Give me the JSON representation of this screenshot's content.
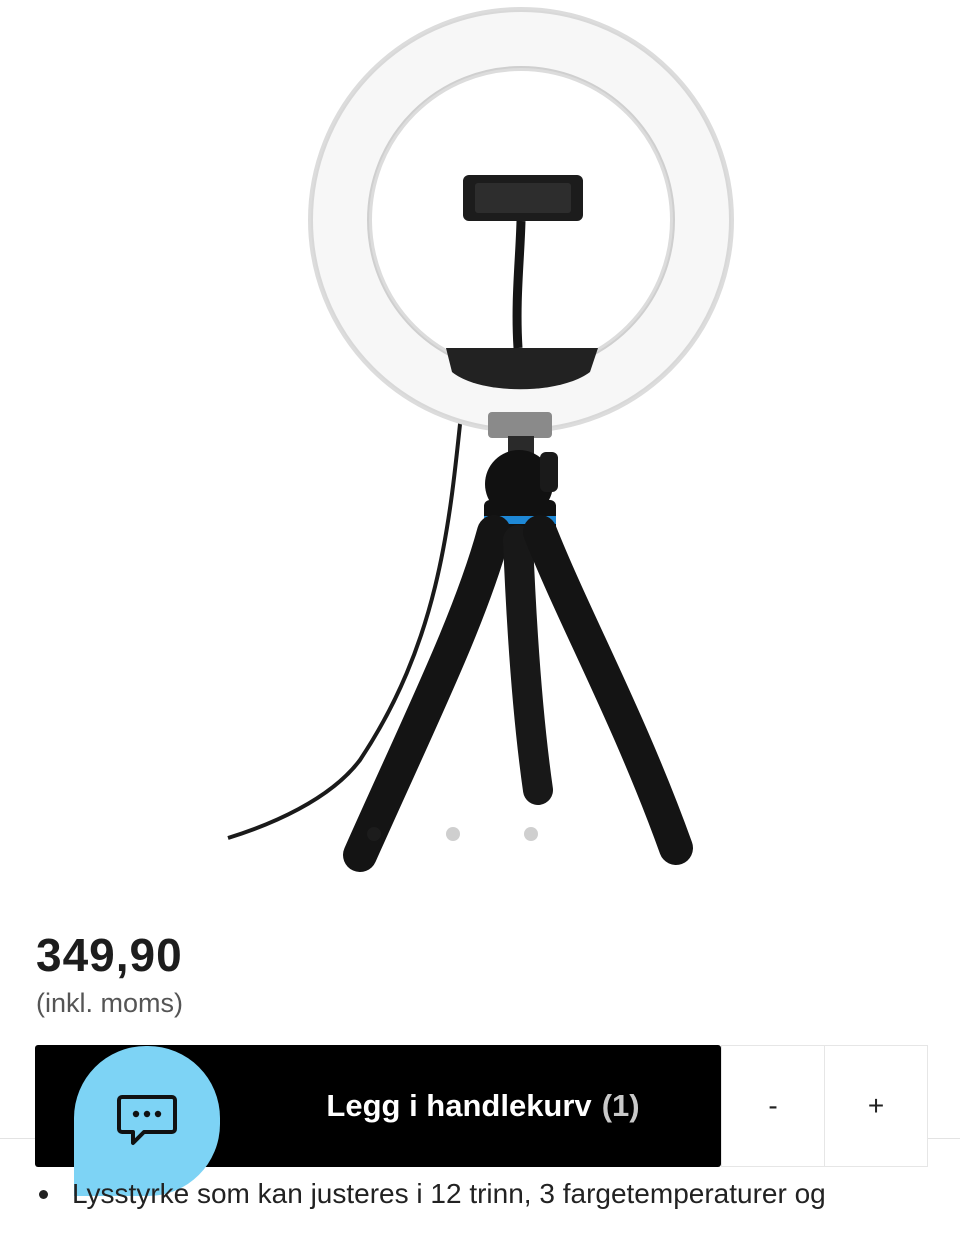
{
  "product": {
    "image_alt": "Ring light with tripod",
    "price": "349,90",
    "vat_note": "(inkl. moms)"
  },
  "carousel": {
    "slides": 3,
    "active_index": 0
  },
  "cart": {
    "add_label": "Legg i handlekurv",
    "count_label": "(1)",
    "decrease_label": "-",
    "increase_label": "+"
  },
  "chat": {
    "icon": "chat-bubble-icon"
  },
  "features": [
    "Lysstyrke som kan justeres i 12 trinn, 3 fargetemperaturer og"
  ],
  "colors": {
    "cart_button": "#000000",
    "chat_button": "#7dd3f5",
    "tripod_band": "#1e88d6"
  }
}
